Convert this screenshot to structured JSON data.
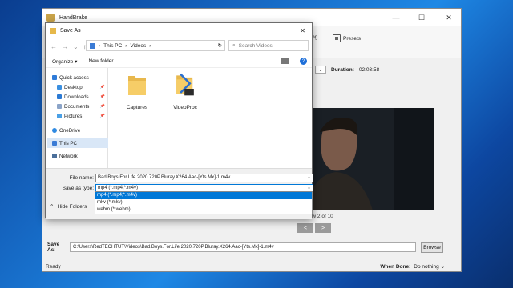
{
  "handbrake": {
    "title": "HandBrake",
    "window_controls": [
      "—",
      "☐",
      "✕"
    ],
    "toolbar": {
      "log_label": "og",
      "presets_label": "Presets"
    },
    "duration_label": "Duration:",
    "duration_value": "02:03:58",
    "preview_caption": "Preview 2 of 10",
    "prev_btn": "<",
    "next_btn": ">",
    "save_as_label": "Save As:",
    "save_as_path": "C:\\Users\\RedTECHTUT\\Videos\\Bad.Boys.For.Life.2020.720P.Bluray.X264.Aac-[Yts.Mx]-1.m4v",
    "browse_label": "Browse",
    "status": "Ready",
    "when_done_label": "When Done:",
    "when_done_value": "Do nothing"
  },
  "dialog": {
    "title": "Save As",
    "close": "✕",
    "breadcrumb": [
      "This PC",
      "Videos"
    ],
    "search_placeholder": "Search Videos",
    "organize_label": "Organize",
    "new_folder_label": "New folder",
    "help": "?",
    "sidebar": [
      {
        "label": "Quick access",
        "icon": "star-icon"
      },
      {
        "label": "Desktop",
        "icon": "desktop-icon"
      },
      {
        "label": "Downloads",
        "icon": "download-icon"
      },
      {
        "label": "Documents",
        "icon": "documents-icon"
      },
      {
        "label": "Pictures",
        "icon": "pictures-icon"
      },
      {
        "label": "OneDrive",
        "icon": "cloud-icon"
      },
      {
        "label": "This PC",
        "icon": "pc-icon"
      },
      {
        "label": "Network",
        "icon": "network-icon"
      }
    ],
    "files": [
      {
        "name": "Captures",
        "icon": "folder-icon"
      },
      {
        "name": "VideoProc",
        "icon": "folder-srt-icon",
        "badge": "SRT"
      }
    ],
    "file_name_label": "File name:",
    "file_name_value": "Bad.Boys.For.Life.2020.720P.Bluray.X264.Aac-[Yts.Mx]-1.m4v",
    "save_as_type_label": "Save as type:",
    "save_as_type_value": "mp4 (*.mp4;*.m4v)",
    "type_options": [
      "mp4 (*.mp4;*.m4v)",
      "mkv (*.mkv)",
      "webm (*.webm)"
    ],
    "hide_folders_label": "Hide Folders"
  },
  "colors": {
    "accent": "#0078d7",
    "desktop": "#1565c0"
  }
}
